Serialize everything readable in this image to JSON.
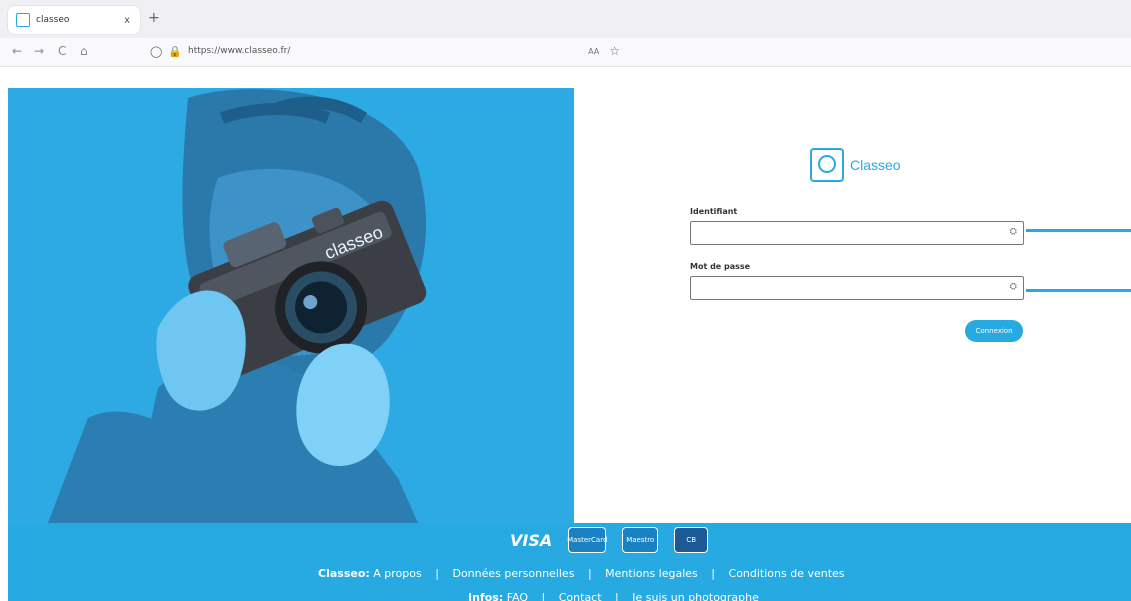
{
  "browser": {
    "tab_title": "classeo",
    "close_label": "x",
    "newtab_label": "+",
    "url": "https://www.classeo.fr/",
    "zoom": "AA",
    "star": "☆"
  },
  "nav": {
    "back": "←",
    "forward": "→",
    "reload": "C",
    "home": "⌂"
  },
  "hero": {
    "image_label": "classeo"
  },
  "login": {
    "logo_text": "Classeo",
    "label_identifiant": "Identifiant",
    "label_password": "Mot de passe",
    "identifiant_value": "",
    "password_value": "",
    "icon_key": "⛭",
    "button_label": "Connexion"
  },
  "footer": {
    "visa": "VISA",
    "mastercard": "MasterCard",
    "maestro": "Maestro",
    "cb": "CB",
    "row1": {
      "brand": "Classeo:",
      "links": [
        "A propos",
        "Données personnelles",
        "Mentions legales",
        "Conditions de ventes"
      ]
    },
    "row2": {
      "brand": "Infos:",
      "links": [
        "FAQ",
        "Contact",
        "Je suis un photographe"
      ]
    },
    "separator": "|"
  },
  "colors": {
    "accent": "#27aae1",
    "footer_bg": "#27aae1"
  }
}
